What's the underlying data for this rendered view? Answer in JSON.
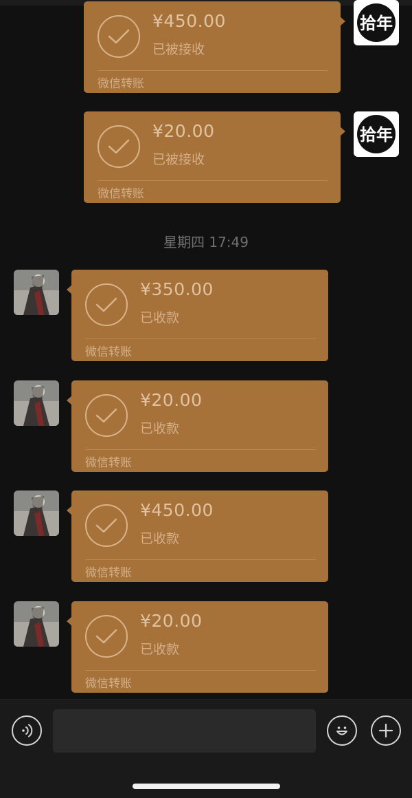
{
  "timestamp": "星期四 17:49",
  "sent_transfers": [
    {
      "amount": "¥450.00",
      "status": "已被接收",
      "footer": "微信转账"
    },
    {
      "amount": "¥20.00",
      "status": "已被接收",
      "footer": "微信转账"
    }
  ],
  "received_transfers": [
    {
      "amount": "¥350.00",
      "status": "已收款",
      "footer": "微信转账"
    },
    {
      "amount": "¥20.00",
      "status": "已收款",
      "footer": "微信转账"
    },
    {
      "amount": "¥450.00",
      "status": "已收款",
      "footer": "微信转账"
    },
    {
      "amount": "¥20.00",
      "status": "已收款",
      "footer": "微信转账"
    }
  ],
  "self_avatar_logo_text": "拾年",
  "input": {
    "value": "",
    "placeholder": ""
  },
  "colors": {
    "background": "#111111",
    "card": "#a7723a",
    "card_text": "#e0c3a0",
    "input_bar": "#1a1a1a"
  },
  "icons": {
    "card_icon": "check-circle-icon",
    "voice": "voice-icon",
    "emoji": "emoji-icon",
    "more": "plus-icon"
  }
}
